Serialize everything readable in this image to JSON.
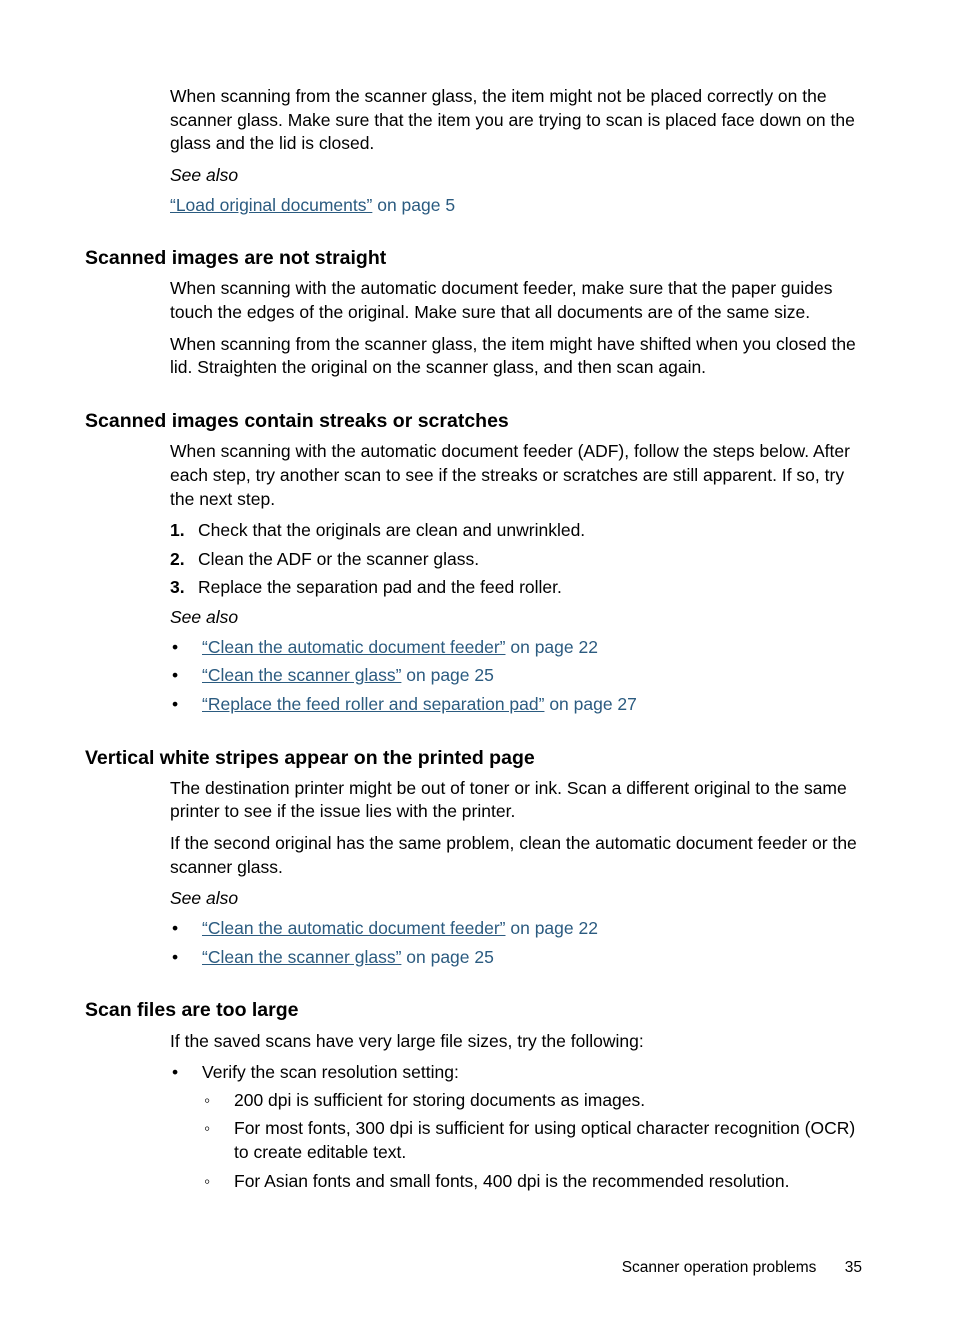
{
  "intro": {
    "para1": "When scanning from the scanner glass, the item might not be placed correctly on the scanner glass. Make sure that the item you are trying to scan is placed face down on the glass and the lid is closed.",
    "see_also_label": "See also",
    "link_text": "“Load original documents”",
    "link_suffix": " on page 5"
  },
  "s1": {
    "heading": "Scanned images are not straight",
    "p1": "When scanning with the automatic document feeder, make sure that the paper guides touch the edges of the original. Make sure that all documents are of the same size.",
    "p2": "When scanning from the scanner glass, the item might have shifted when you closed the lid. Straighten the original on the scanner glass, and then scan again."
  },
  "s2": {
    "heading": "Scanned images contain streaks or scratches",
    "p1": "When scanning with the automatic document feeder (ADF), follow the steps below. After each step, try another scan to see if the streaks or scratches are still apparent. If so, try the next step.",
    "ol": [
      "Check that the originals are clean and unwrinkled.",
      "Clean the ADF or the scanner glass.",
      "Replace the separation pad and the feed roller."
    ],
    "see_also_label": "See also",
    "links": [
      {
        "text": "“Clean the automatic document feeder”",
        "suffix": " on page 22"
      },
      {
        "text": "“Clean the scanner glass”",
        "suffix": " on page 25"
      },
      {
        "text": "“Replace the feed roller and separation pad”",
        "suffix": " on page 27"
      }
    ]
  },
  "s3": {
    "heading": "Vertical white stripes appear on the printed page",
    "p1": "The destination printer might be out of toner or ink. Scan a different original to the same printer to see if the issue lies with the printer.",
    "p2": "If the second original has the same problem, clean the automatic document feeder or the scanner glass.",
    "see_also_label": "See also",
    "links": [
      {
        "text": "“Clean the automatic document feeder”",
        "suffix": " on page 22"
      },
      {
        "text": "“Clean the scanner glass”",
        "suffix": " on page 25"
      }
    ]
  },
  "s4": {
    "heading": "Scan files are too large",
    "p1": "If the saved scans have very large file sizes, try the following:",
    "item0": "Verify the scan resolution setting:",
    "subs": [
      "200 dpi is sufficient for storing documents as images.",
      "For most fonts, 300 dpi is sufficient for using optical character recognition (OCR) to create editable text.",
      "For Asian fonts and small fonts, 400 dpi is the recommended resolution."
    ]
  },
  "footer": {
    "text": "Scanner operation problems",
    "page": "35"
  }
}
